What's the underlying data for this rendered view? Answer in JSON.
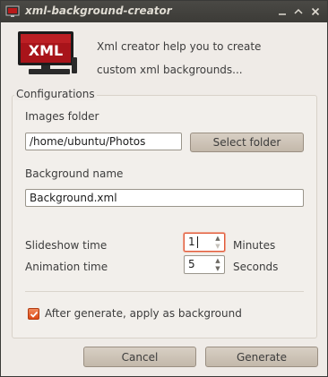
{
  "window": {
    "title": "xml-background-creator",
    "controls": {
      "minimize_icon": "minimize-icon",
      "maximize_icon": "maximize-icon",
      "close_icon": "close-icon"
    }
  },
  "header": {
    "logo_text": "XML",
    "intro_line1": "Xml creator help you to create",
    "intro_line2": "custom xml backgrounds..."
  },
  "configurations": {
    "group_label": "Configurations",
    "images_folder_label": "Images folder",
    "images_folder_value": "/home/ubuntu/Photos",
    "select_folder_button": "Select folder",
    "background_name_label": "Background name",
    "background_name_value": "Background.xml",
    "slideshow_time_label": "Slideshow time",
    "slideshow_time_value": "1",
    "slideshow_time_unit": "Minutes",
    "animation_time_label": "Animation time",
    "animation_time_value": "5",
    "animation_time_unit": "Seconds",
    "apply_checkbox_label": "After generate, apply as background",
    "apply_checkbox_checked": true
  },
  "footer": {
    "cancel_button": "Cancel",
    "generate_button": "Generate"
  },
  "colors": {
    "titlebar": "#3c3b37",
    "window_bg": "#efebe7",
    "accent": "#dd4814",
    "button": "#c9bfb2"
  }
}
